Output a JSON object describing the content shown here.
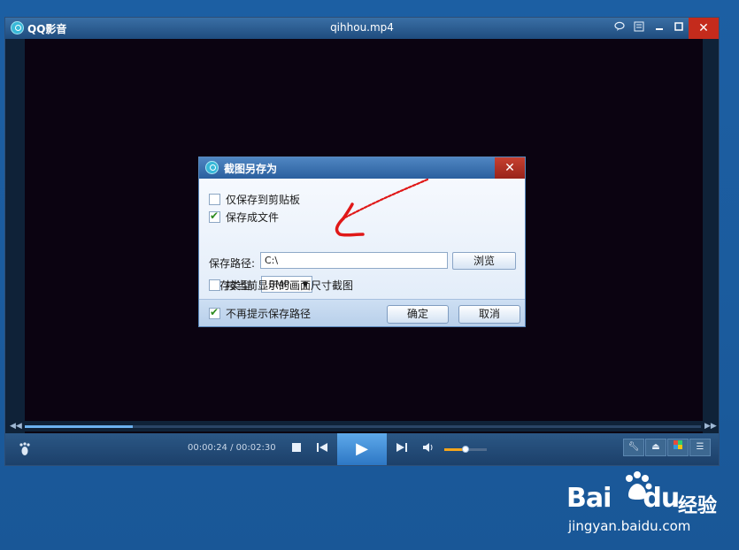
{
  "player": {
    "app_name": "QQ影音",
    "file_title": "qihhou.mp4",
    "time_current": "00:00:24",
    "time_separator": " / ",
    "time_total": "00:02:30",
    "seek_progress": 0.16,
    "volume_level": 0.5,
    "titlebar_icons": [
      "chat-icon",
      "list-icon",
      "minimize-icon",
      "maximize-icon"
    ],
    "control_icons": [
      "stop-icon",
      "prev-icon",
      "play-icon",
      "next-icon",
      "volume-icon"
    ],
    "tool_icons": [
      "wrench-icon",
      "eject-icon",
      "color-icon",
      "playlist-icon"
    ]
  },
  "dialog": {
    "title": "截图另存为",
    "options": [
      {
        "label": "仅保存到剪贴板",
        "checked": false
      },
      {
        "label": "保存成文件",
        "checked": true
      }
    ],
    "path_label": "保存路径:",
    "path_value": "C:\\",
    "browse_label": "浏览",
    "type_label": "保存类型:",
    "type_value": ".BMP",
    "size_option": {
      "label": "按当前显示的画面尺寸截图",
      "checked": false
    },
    "no_prompt": {
      "label": "不再提示保存路径",
      "checked": true
    },
    "ok_label": "确定",
    "cancel_label": "取消"
  },
  "watermark": {
    "brand": "Bai",
    "brand_suffix": "du",
    "brand_cn": "经验",
    "url": "jingyan.baidu.com"
  },
  "colors": {
    "desktop": "#1a5a9c",
    "accent": "#5ea9ea",
    "close": "#c42b1c",
    "annotation": "#e01818"
  }
}
